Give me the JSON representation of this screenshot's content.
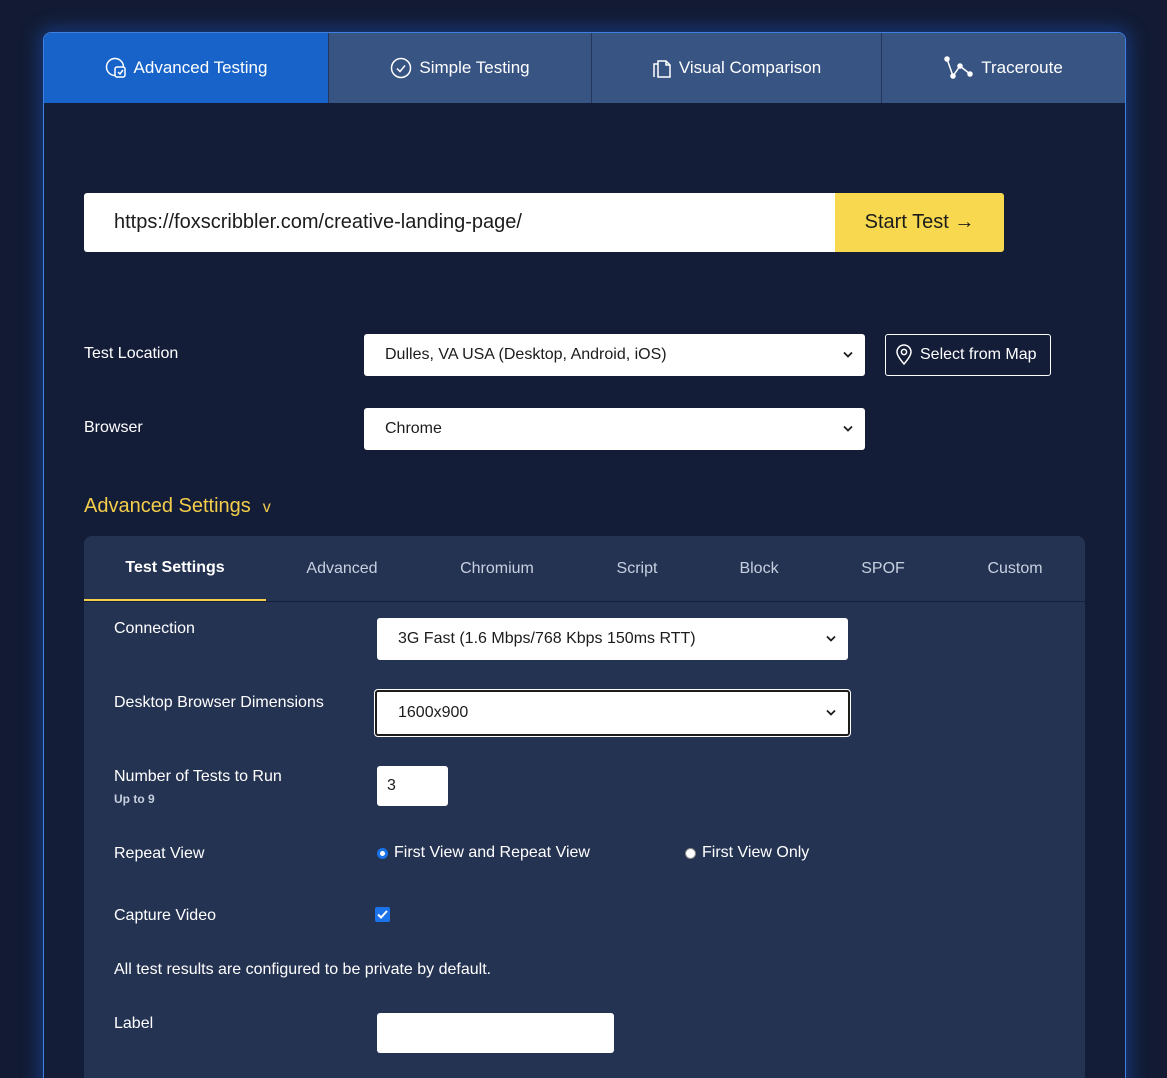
{
  "tabs": [
    {
      "label": "Advanced Testing",
      "icon": "advanced-testing-icon",
      "active": true
    },
    {
      "label": "Simple Testing",
      "icon": "check-circle-icon",
      "active": false
    },
    {
      "label": "Visual Comparison",
      "icon": "copy-documents-icon",
      "active": false
    },
    {
      "label": "Traceroute",
      "icon": "route-nodes-icon",
      "active": false
    }
  ],
  "url_form": {
    "url_value": "https://foxscribbler.com/creative-landing-page/",
    "start_label": "Start Test →"
  },
  "test_location": {
    "label": "Test Location",
    "selected": "Dulles, VA USA (Desktop, Android, iOS)",
    "map_button": "Select from Map"
  },
  "browser": {
    "label": "Browser",
    "selected": "Chrome"
  },
  "advanced_settings": {
    "toggle_label": "Advanced Settings",
    "toggle_glyph": "v",
    "subtabs": [
      "Test Settings",
      "Advanced",
      "Chromium",
      "Script",
      "Block",
      "SPOF",
      "Custom"
    ],
    "active_subtab": "Test Settings"
  },
  "test_settings": {
    "connection": {
      "label": "Connection",
      "selected": "3G Fast (1.6 Mbps/768 Kbps 150ms RTT)"
    },
    "dimensions": {
      "label": "Desktop Browser Dimensions",
      "selected": "1600x900"
    },
    "num_tests": {
      "label": "Number of Tests to Run",
      "hint": "Up to 9",
      "value": "3"
    },
    "repeat_view": {
      "label": "Repeat View",
      "options": [
        "First View and Repeat View",
        "First View Only"
      ],
      "selected": "First View and Repeat View"
    },
    "capture_video": {
      "label": "Capture Video",
      "checked": true
    },
    "privacy_note": "All test results are configured to be private by default.",
    "label_field": {
      "label": "Label",
      "value": ""
    }
  },
  "colors": {
    "accent_yellow": "#f8d84e",
    "active_tab_blue": "#1763c9",
    "tab_blue": "#385483",
    "background": "#141d38",
    "settings_panel": "#253352"
  }
}
